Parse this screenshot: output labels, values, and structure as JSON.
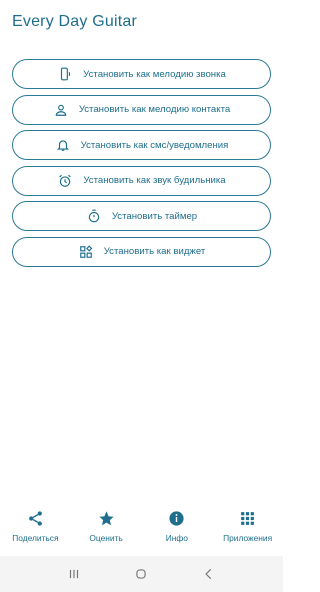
{
  "app": {
    "title": "Every Day Guitar"
  },
  "colors": {
    "accent": "#1e6e8c",
    "border": "#2d7a96",
    "system_bar": "#f4f4f4"
  },
  "actions": [
    {
      "icon": "phone-ringtone-icon",
      "label": "Установить как мелодию звонка"
    },
    {
      "icon": "contact-person-icon",
      "label": "Установить как мелодию контакта"
    },
    {
      "icon": "bell-icon",
      "label": "Установить как смс/уведомления"
    },
    {
      "icon": "alarm-clock-icon",
      "label": "Установить как звук будильника"
    },
    {
      "icon": "timer-icon",
      "label": "Установить таймер"
    },
    {
      "icon": "widget-icon",
      "label": "Установить как виджет"
    }
  ],
  "bottom_nav": [
    {
      "icon": "share-icon",
      "label": "Поделиться"
    },
    {
      "icon": "star-icon",
      "label": "Оценить"
    },
    {
      "icon": "info-icon",
      "label": "Инфо"
    },
    {
      "icon": "apps-grid-icon",
      "label": "Приложения"
    }
  ],
  "system_nav": [
    "recents-icon",
    "home-icon",
    "back-icon"
  ]
}
